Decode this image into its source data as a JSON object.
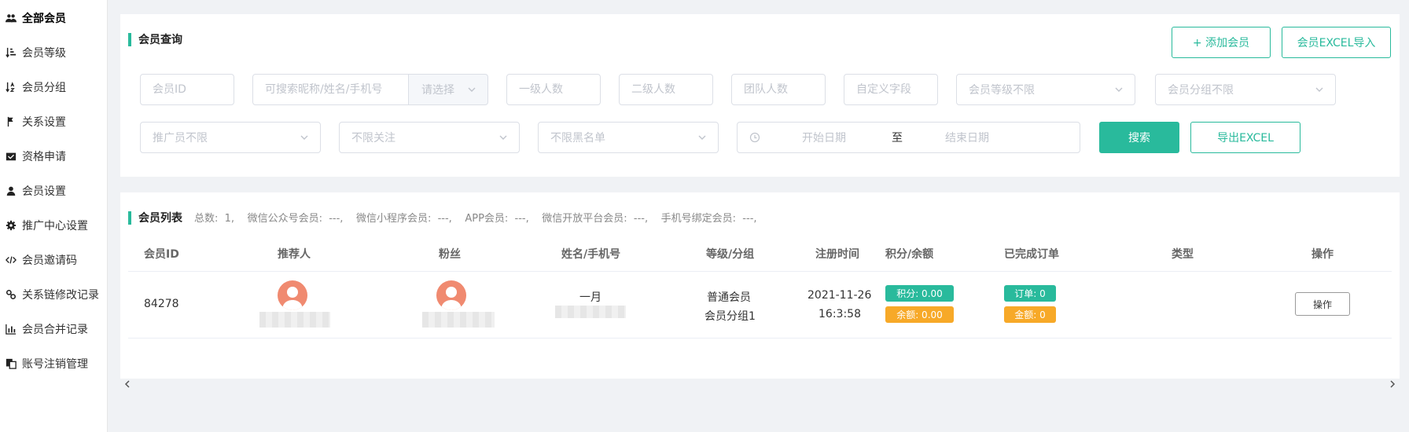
{
  "sidebar": {
    "items": [
      {
        "label": "全部会员",
        "icon": "users-icon",
        "active": true
      },
      {
        "label": "会员等级",
        "icon": "sort-amount-icon"
      },
      {
        "label": "会员分组",
        "icon": "sort-alpha-icon"
      },
      {
        "label": "关系设置",
        "icon": "flag-icon"
      },
      {
        "label": "资格申请",
        "icon": "inbox-icon"
      },
      {
        "label": "会员设置",
        "icon": "user-icon"
      },
      {
        "label": "推广中心设置",
        "icon": "gear-icon"
      },
      {
        "label": "会员邀请码",
        "icon": "code-icon"
      },
      {
        "label": "关系链修改记录",
        "icon": "link-icon"
      },
      {
        "label": "会员合并记录",
        "icon": "bar-chart-icon"
      },
      {
        "label": "账号注销管理",
        "icon": "copy-icon"
      }
    ]
  },
  "query": {
    "title": "会员查询",
    "add_member": "+ 添加会员",
    "excel_import": "会员EXCEL导入",
    "member_id_ph": "会员ID",
    "search_ph": "可搜索昵称/姓名/手机号",
    "select_append": "请选择",
    "level1_ph": "一级人数",
    "level2_ph": "二级人数",
    "team_ph": "团队人数",
    "custom_ph": "自定义字段",
    "level_select": "会员等级不限",
    "group_select": "会员分组不限",
    "promoter_select": "推广员不限",
    "follow_select": "不限关注",
    "blacklist_select": "不限黑名单",
    "start_date_ph": "开始日期",
    "date_sep": "至",
    "end_date_ph": "结束日期",
    "search_btn": "搜索",
    "export_btn": "导出EXCEL"
  },
  "list": {
    "title": "会员列表",
    "stats": "总数:  1,    微信公众号会员:  ---,    微信小程序会员:  ---,    APP会员:  ---,    微信开放平台会员:  ---,    手机号绑定会员:  ---,",
    "columns": [
      "会员ID",
      "推荐人",
      "粉丝",
      "姓名/手机号",
      "等级/分组",
      "注册时间",
      "积分/余额",
      "已完成订单",
      "类型",
      "操作"
    ],
    "rows": [
      {
        "id": "84278",
        "name": "一月",
        "level": "普通会员",
        "group": "会员分组1",
        "reg_date": "2021-11-26",
        "reg_time": "16:3:58",
        "points": "积分: 0.00",
        "balance": "余额: 0.00",
        "orders": "订单: 0",
        "amount": "金额: 0",
        "type": "",
        "op": "操作"
      }
    ]
  },
  "colors": {
    "accent": "#29ba9c",
    "orange": "#f7a928",
    "avatar": "#f08a70"
  }
}
